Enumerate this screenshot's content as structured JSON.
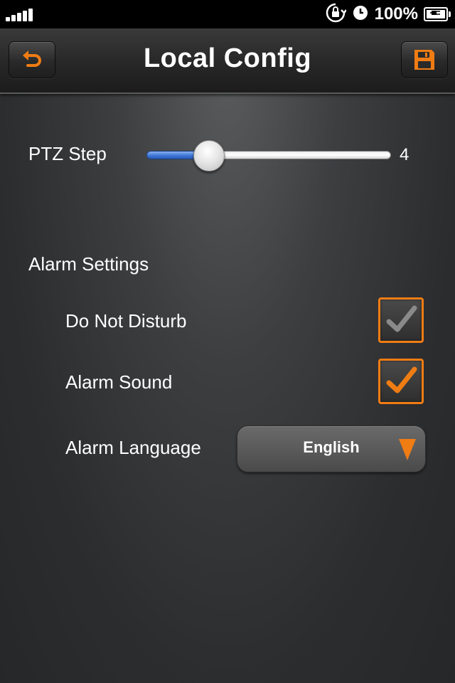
{
  "status_bar": {
    "battery_percent": "100%",
    "icons": [
      "signal-bars-icon",
      "rotation-lock-icon",
      "alarm-clock-icon",
      "battery-charging-icon"
    ]
  },
  "nav": {
    "title": "Local Config",
    "back_icon": "undo-arrow-icon",
    "save_icon": "floppy-disk-icon",
    "accent": "#f07c14"
  },
  "ptz": {
    "label": "PTZ Step",
    "value": "4",
    "slider_fraction": 0.25
  },
  "alarm": {
    "section_title": "Alarm Settings",
    "do_not_disturb": {
      "label": "Do Not Disturb",
      "checked": false
    },
    "alarm_sound": {
      "label": "Alarm Sound",
      "checked": true
    },
    "language": {
      "label": "Alarm Language",
      "selected": "English"
    }
  },
  "colors": {
    "accent": "#f07c14",
    "slider_fill": "#3f77d8",
    "background": "#2b2d2f"
  }
}
